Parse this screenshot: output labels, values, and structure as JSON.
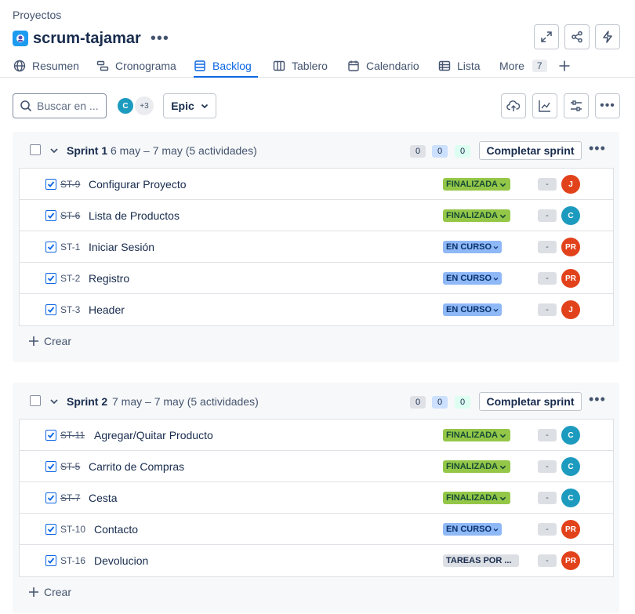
{
  "breadcrumb": "Proyectos",
  "project": {
    "title": "scrum-tajamar",
    "more": "•••"
  },
  "top_actions": [
    {
      "icon": "fullscreen-icon"
    },
    {
      "icon": "share-icon"
    },
    {
      "icon": "automation-icon"
    }
  ],
  "tabs": [
    {
      "label": "Resumen",
      "icon": "globe-icon"
    },
    {
      "label": "Cronograma",
      "icon": "timeline-icon"
    },
    {
      "label": "Backlog",
      "icon": "backlog-icon",
      "active": true
    },
    {
      "label": "Tablero",
      "icon": "board-icon"
    },
    {
      "label": "Calendario",
      "icon": "calendar-icon"
    },
    {
      "label": "Lista",
      "icon": "list-icon"
    },
    {
      "label": "More",
      "count": "7"
    }
  ],
  "toolbar": {
    "search_placeholder": "Buscar en ...",
    "avatar_initial": "C",
    "avatar_extra": "+3",
    "epic_label": "Epic"
  },
  "colors": {
    "accent": "#0c66e4",
    "avatar_teal": "#1d9bbf",
    "avatar_orange": "#e2421b",
    "status_done": "#94c748",
    "status_in_progress": "#8fb8f6",
    "status_todo": "#dcdfe4"
  },
  "sprints": [
    {
      "name": "Sprint 1",
      "dates": "6 may – 7 may (5 actividades)",
      "counts": [
        "0",
        "0",
        "0"
      ],
      "complete_label": "Completar sprint",
      "create_label": "Crear",
      "issues": [
        {
          "key": "ST-9",
          "title": "Configurar Proyecto",
          "status": "FINALIZADA",
          "estimate": "-",
          "assignee": "J",
          "done": true
        },
        {
          "key": "ST-6",
          "title": "Lista de Productos",
          "status": "FINALIZADA",
          "estimate": "-",
          "assignee": "C",
          "done": true
        },
        {
          "key": "ST-1",
          "title": "Iniciar Sesión",
          "status": "EN CURSO",
          "estimate": "-",
          "assignee": "PR",
          "done": false
        },
        {
          "key": "ST-2",
          "title": "Registro",
          "status": "EN CURSO",
          "estimate": "-",
          "assignee": "PR",
          "done": false
        },
        {
          "key": "ST-3",
          "title": "Header",
          "status": "EN CURSO",
          "estimate": "-",
          "assignee": "J",
          "done": false
        }
      ]
    },
    {
      "name": "Sprint 2",
      "dates": "7 may – 7 may (5 actividades)",
      "counts": [
        "0",
        "0",
        "0"
      ],
      "complete_label": "Completar sprint",
      "create_label": "Crear",
      "issues": [
        {
          "key": "ST-11",
          "title": "Agregar/Quitar Producto",
          "status": "FINALIZADA",
          "estimate": "-",
          "assignee": "C",
          "done": true
        },
        {
          "key": "ST-5",
          "title": "Carrito de Compras",
          "status": "FINALIZADA",
          "estimate": "-",
          "assignee": "C",
          "done": true
        },
        {
          "key": "ST-7",
          "title": "Cesta",
          "status": "FINALIZADA",
          "estimate": "-",
          "assignee": "C",
          "done": true
        },
        {
          "key": "ST-10",
          "title": "Contacto",
          "status": "EN CURSO",
          "estimate": "-",
          "assignee": "PR",
          "done": false
        },
        {
          "key": "ST-16",
          "title": "Devolucion",
          "status": "TAREAS POR ...",
          "estimate": "-",
          "assignee": "PR",
          "done": false
        }
      ]
    }
  ]
}
